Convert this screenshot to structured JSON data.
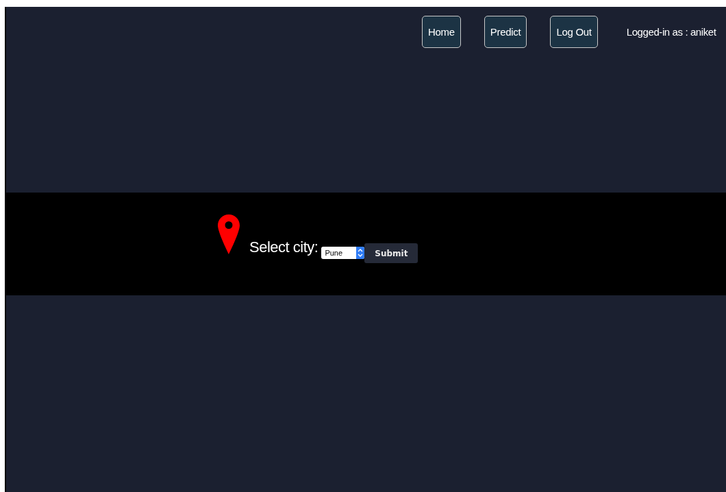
{
  "nav": {
    "buttons": [
      {
        "label": "Home"
      },
      {
        "label": "Predict"
      },
      {
        "label": "Log Out"
      }
    ],
    "user_text": "Logged-in as : aniket"
  },
  "city_form": {
    "label": "Select city:",
    "select_value": "Pune",
    "submit": "Submit"
  }
}
